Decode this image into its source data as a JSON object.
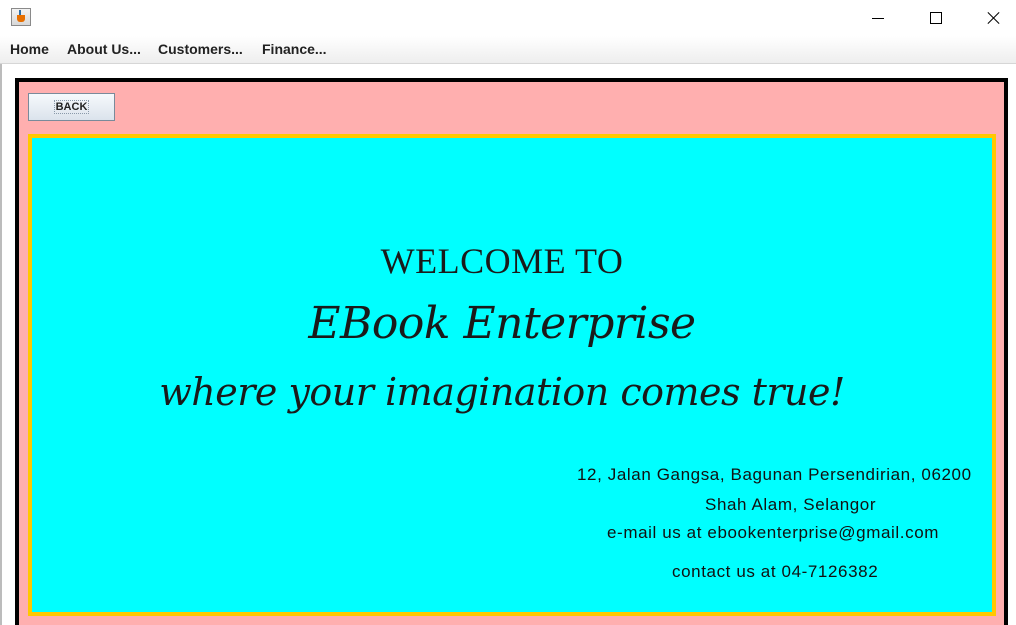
{
  "window": {
    "controls": {
      "minimize_icon": "minimize-icon",
      "maximize_icon": "maximize-icon",
      "close_icon": "close-icon"
    },
    "app_icon": "java-cup-icon"
  },
  "menubar": {
    "items": [
      {
        "label": "Home"
      },
      {
        "label": "About Us..."
      },
      {
        "label": "Customers..."
      },
      {
        "label": "Finance..."
      }
    ]
  },
  "panel": {
    "back_label": "BACK",
    "welcome": "WELCOME TO",
    "brand": "EBook Enterprise",
    "tagline": "where your imagination comes true!",
    "address_line1": "12, Jalan Gangsa, Bagunan Persendirian, 06200",
    "address_line2": "Shah Alam, Selangor",
    "email_line": "e-mail us at ebookenterprise@gmail.com",
    "contact_line": "contact us at 04-7126382"
  },
  "colors": {
    "outer_background": "#ffafaf",
    "inner_background": "#00ffff",
    "inner_border": "#ffc800",
    "outer_border": "#000000"
  }
}
